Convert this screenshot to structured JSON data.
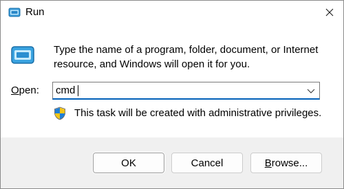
{
  "window": {
    "title": "Run",
    "title_icon": "run-icon",
    "close_icon": "close-icon"
  },
  "message": {
    "line1": "Type the name of a program, folder, document, or Internet",
    "line2": "resource, and Windows will open it for you."
  },
  "open_field": {
    "label_mnemonic": "O",
    "label_rest": "pen:",
    "value": "cmd",
    "dropdown_icon": "chevron-down-icon"
  },
  "admin_note": {
    "icon": "shield-icon",
    "text": "This task will be created with administrative privileges."
  },
  "buttons": {
    "ok": "OK",
    "cancel": "Cancel",
    "browse_mnemonic": "B",
    "browse_rest": "rowse..."
  },
  "colors": {
    "accent": "#005fb8",
    "footer_bg": "#f0f0f0",
    "border": "#8a8a8a"
  }
}
